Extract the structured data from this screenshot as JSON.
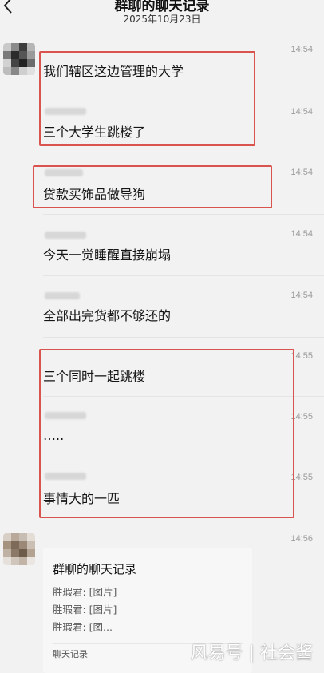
{
  "header": {
    "title": "群聊的聊天记录",
    "date": "2025年10月23日"
  },
  "messages": [
    {
      "time": "14:54",
      "text": "我们辖区这边管理的大学"
    },
    {
      "time": "14:54",
      "text": "三个大学生跳楼了"
    },
    {
      "time": "14:54",
      "text": "贷款买饰品做导狗"
    },
    {
      "time": "14:54",
      "text": "今天一觉睡醒直接崩塌"
    },
    {
      "time": "14:54",
      "text": "全部出完货都不够还的"
    },
    {
      "time": "14:55",
      "text": "三个同时一起跳楼"
    },
    {
      "time": "14:55",
      "text": "….."
    },
    {
      "time": "14:55",
      "text": "事情大的一匹"
    }
  ],
  "forward_card": {
    "time": "14:56",
    "title": "群聊的聊天记录",
    "lines": [
      "胜瑕君: [图片]",
      "胜瑕君: [图片]",
      "胜瑕君: [图..."
    ],
    "footer": "聊天记录"
  },
  "watermark": "风易号 | 社会酱",
  "colors": {
    "highlight": "#d9534f",
    "background": "#f2f2f2"
  }
}
